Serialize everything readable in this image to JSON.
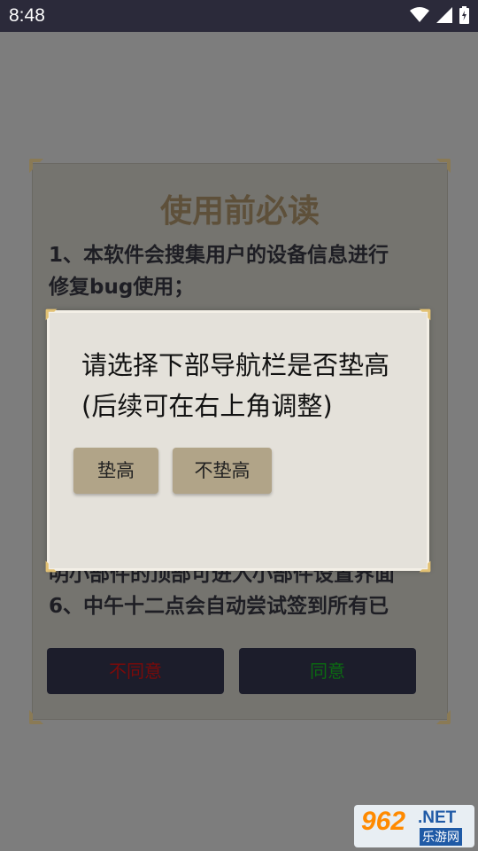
{
  "status_bar": {
    "time": "8:48"
  },
  "notice": {
    "title": "使用前必读",
    "lines": [
      "1、本软件会搜集用户的设备信息进行",
      "修复bug使用；",
      "明小部件的顶部可进入小部件设置界面",
      "6、中午十二点会自动尝试签到所有已"
    ],
    "disagree_label": "不同意",
    "agree_label": "同意",
    "disagree_color": "#7a0a0a",
    "agree_color": "#0b6a12"
  },
  "dialog": {
    "message": "请选择下部导航栏是否垫高(后续可在右上角调整)",
    "raise_label": "垫高",
    "no_raise_label": "不垫高"
  },
  "watermark": {
    "number": "962",
    "suffix": ".NET",
    "subtitle": "乐游网"
  }
}
